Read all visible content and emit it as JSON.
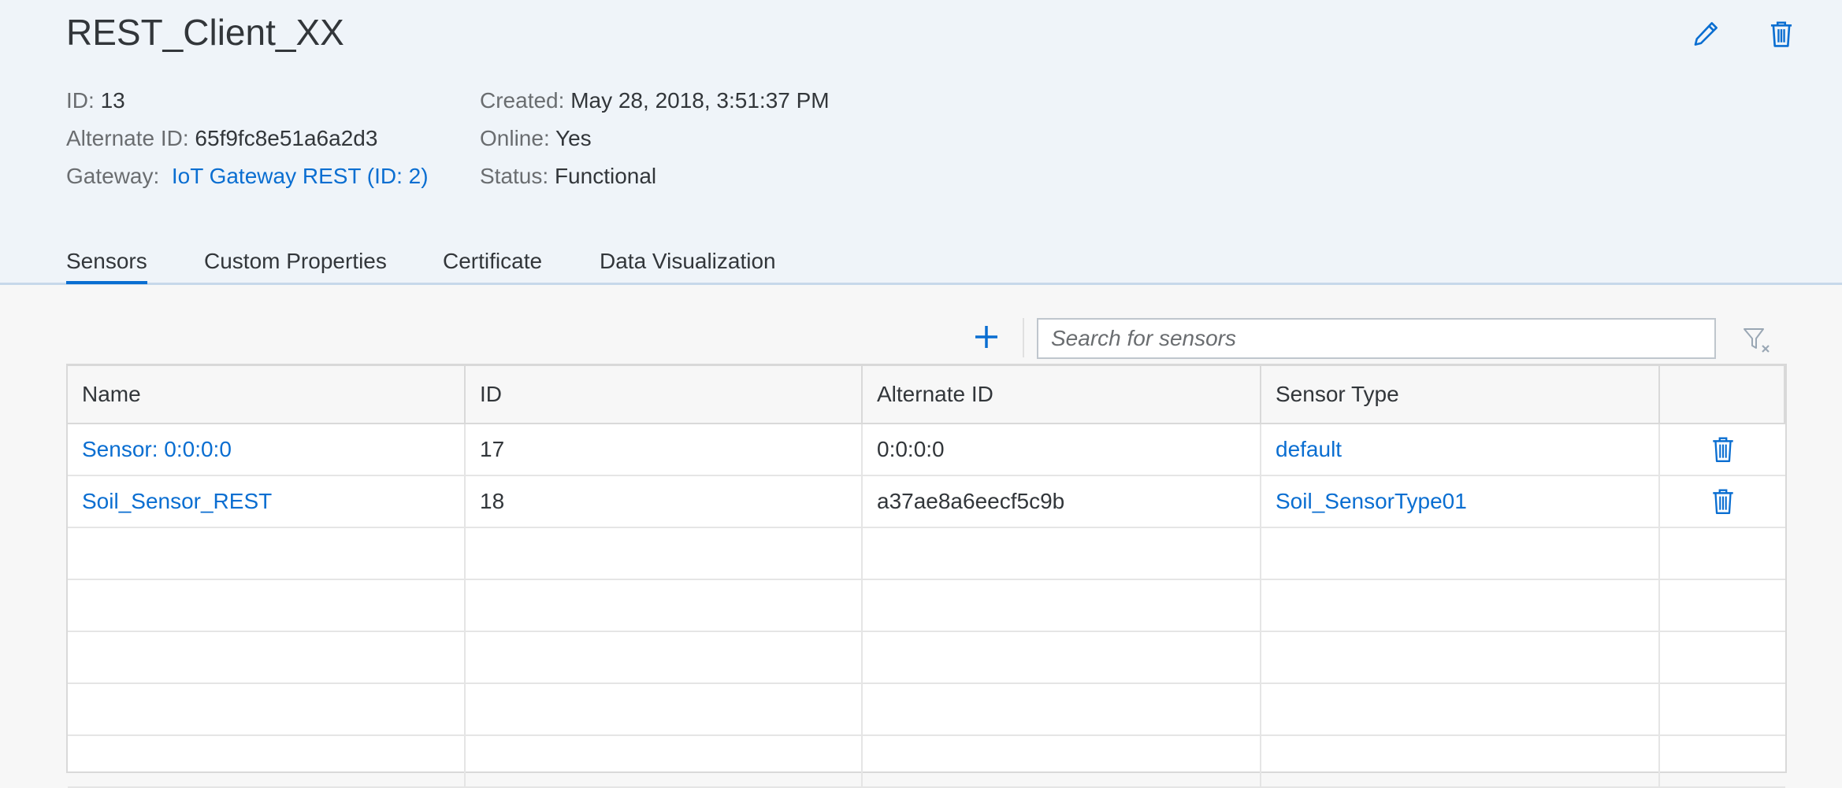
{
  "header": {
    "title": "REST_Client_XX",
    "icons": {
      "edit": "pencil-icon",
      "delete": "trash-icon"
    },
    "left_attrs": {
      "id_label": "ID:",
      "id_value": "13",
      "alt_label": "Alternate ID:",
      "alt_value": "65f9fc8e51a6a2d3",
      "gateway_label": "Gateway:",
      "gateway_value": "IoT Gateway REST (ID: 2)"
    },
    "right_attrs": {
      "created_label": "Created:",
      "created_value": "May 28, 2018, 3:51:37 PM",
      "online_label": "Online:",
      "online_value": "Yes",
      "status_label": "Status:",
      "status_value": "Functional"
    }
  },
  "tabs": [
    {
      "label": "Sensors",
      "active": true
    },
    {
      "label": "Custom Properties",
      "active": false
    },
    {
      "label": "Certificate",
      "active": false
    },
    {
      "label": "Data Visualization",
      "active": false
    }
  ],
  "toolbar": {
    "add_icon": "plus-icon",
    "search_placeholder": "Search for sensors",
    "filter_icon": "filter-clear-icon"
  },
  "table": {
    "columns": [
      "Name",
      "ID",
      "Alternate ID",
      "Sensor Type",
      ""
    ],
    "rows": [
      {
        "name": "Sensor: 0:0:0:0",
        "id": "17",
        "alternate_id": "0:0:0:0",
        "sensor_type": "default"
      },
      {
        "name": "Soil_Sensor_REST",
        "id": "18",
        "alternate_id": "a37ae8a6eecf5c9b",
        "sensor_type": "Soil_SensorType01"
      }
    ],
    "empty_rows": 5
  },
  "colors": {
    "accent": "#0a6ed1",
    "header_bg": "#eff4f9",
    "text": "#32363a",
    "label": "#6a6d70"
  }
}
